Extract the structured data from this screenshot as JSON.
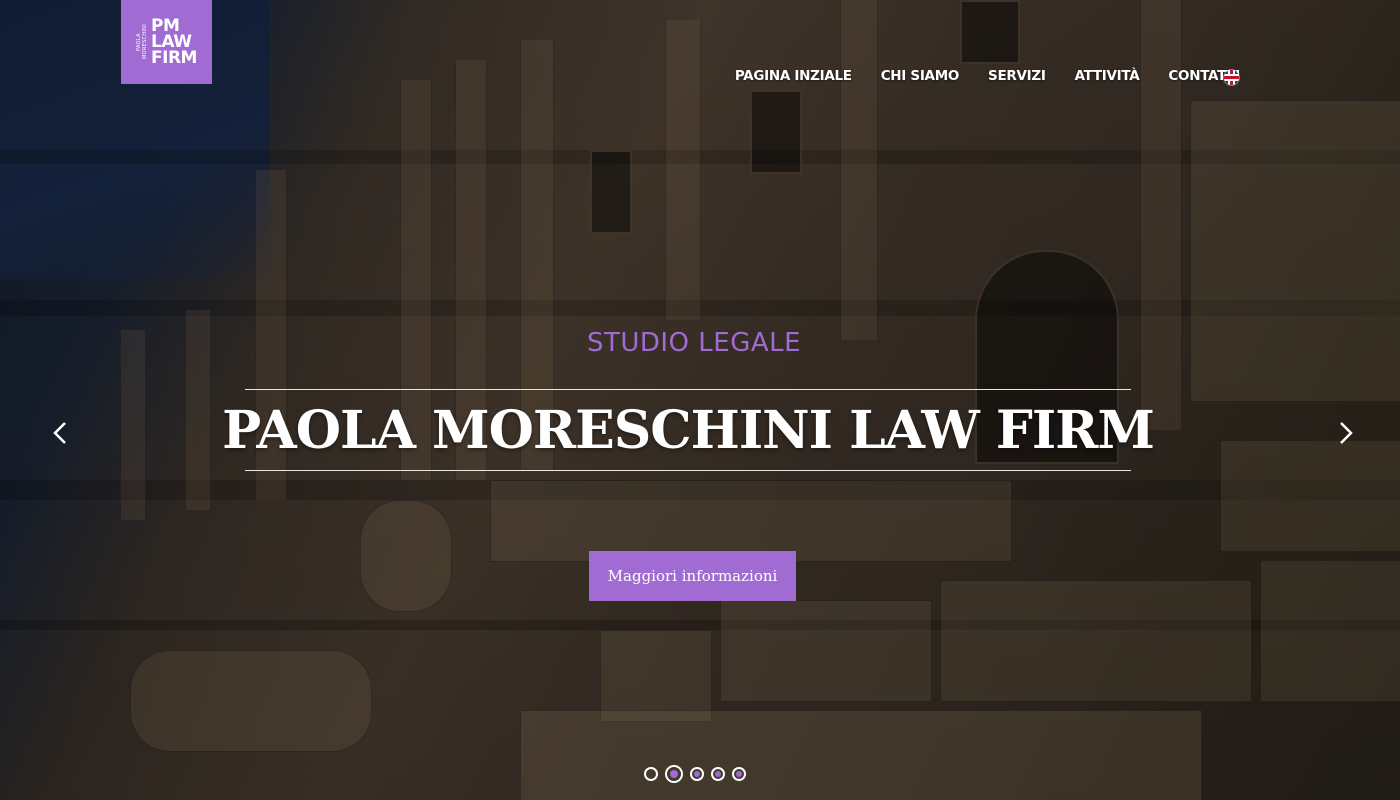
{
  "logo": {
    "side_text": "PAOLA MORESCHINI",
    "lines": [
      "PM",
      "LAW",
      "FIRM"
    ]
  },
  "nav": {
    "items": [
      {
        "label": "PAGINA INZIALE"
      },
      {
        "label": "CHI SIAMO"
      },
      {
        "label": "SERVIZI"
      },
      {
        "label": "ATTIVITÀ"
      },
      {
        "label": "CONTATTI"
      }
    ],
    "language_icon": "uk-flag-icon"
  },
  "hero": {
    "subtitle": "STUDIO LEGALE",
    "title": "PAOLA MORESCHINI LAW FIRM",
    "cta_label": "Maggiori informazioni",
    "prev_icon": "chevron-left-icon",
    "next_icon": "chevron-right-icon",
    "slide_count": 5,
    "active_slide": 2
  },
  "colors": {
    "accent": "#a06bd2",
    "text": "#ffffff"
  }
}
